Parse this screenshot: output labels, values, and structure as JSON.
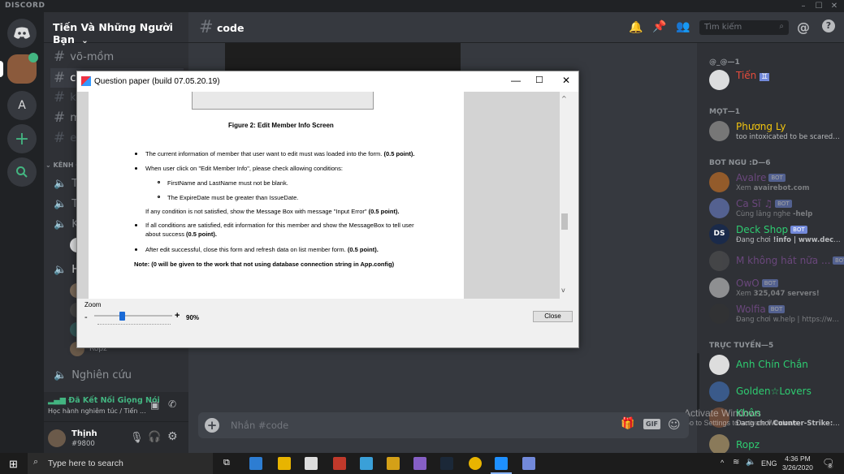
{
  "app": {
    "brand": "DISCORD"
  },
  "server": {
    "name": "Tiến Và Những Người Bạn"
  },
  "channels": [
    {
      "name": "võ-mồm"
    },
    {
      "name": "co"
    },
    {
      "name": "ki"
    },
    {
      "name": "m"
    },
    {
      "name": "e"
    }
  ],
  "voice_category": "KÊNH Đ",
  "voice_channels": [
    {
      "name": "Tì"
    },
    {
      "name": "Tì"
    },
    {
      "name": "Ka"
    },
    {
      "name": "H"
    }
  ],
  "voice_user_last": "Ropz",
  "voice_channel_research": "Nghiên cứu",
  "voice_status": {
    "title": "Đã Kết Nối Giọng Nói",
    "sub": "Học hành nghiêm túc / Tiến ..."
  },
  "user": {
    "name": "Thịnh",
    "tag": "#9800"
  },
  "chat": {
    "channel": "code",
    "placeholder": "Nhắn #code"
  },
  "search": {
    "placeholder": "Tìm kiếm"
  },
  "members": {
    "sections": [
      {
        "title": "@_@—1",
        "members": [
          {
            "name": "Tiến",
            "badge": "♊",
            "color": "#e74c3c",
            "status": ""
          }
        ]
      },
      {
        "title": "MỌT—1",
        "members": [
          {
            "name": "Phương Ly",
            "color": "#f1c40f",
            "status": "too intoxicated to be scared U..."
          }
        ]
      },
      {
        "title": "BOT NGU :D—6",
        "members": [
          {
            "name": "Avalre",
            "color": "#9b59b6",
            "bot": "BOT",
            "status_pre": "Xem ",
            "status": "avairebot.com"
          },
          {
            "name": "Ca Sĩ ♫",
            "color": "#9b59b6",
            "bot": "BOT",
            "status_pre": "Cùng lắng nghe ",
            "status": "-help"
          },
          {
            "name": "Deck Shop",
            "color": "#2ecc71",
            "bot": "BOT",
            "status_pre": "Đang chơi ",
            "status": "!info | www.decksh..."
          },
          {
            "name": "M không hát nữa ...",
            "color": "#9b59b6",
            "bot": "BOT",
            "status": ""
          },
          {
            "name": "OwO",
            "color": "#9b59b6",
            "bot": "BOT",
            "status_pre": "Xem ",
            "status": "325,047 servers!"
          },
          {
            "name": "Wolfia",
            "color": "#9b59b6",
            "bot": "BOT",
            "status_pre": "Đang chơi ",
            "status": "w.help | https://wo..."
          }
        ]
      },
      {
        "title": "TRỰC TUYẾN—5",
        "members": [
          {
            "name": "Anh Chín Chắn",
            "color": "#2ecc71"
          },
          {
            "name": "Golden☆Lovers",
            "color": "#2ecc71"
          },
          {
            "name": "Khôn",
            "color": "#2ecc71",
            "status_pre": "Đang chơi ",
            "status": "Counter-Strike: ..."
          },
          {
            "name": "Ropz",
            "color": "#2ecc71"
          }
        ]
      }
    ]
  },
  "watermark": {
    "line1": "Activate Windows",
    "line2": "Go to Settings to activate Windows."
  },
  "dialog": {
    "title": "Question paper (build 07.05.20.19)",
    "figure_caption": "Figure 2: Edit Member Info Screen",
    "bullets": [
      {
        "text": "The current information of member that user want to edit must was loaded into the form. ",
        "bold": "(0.5 point)."
      },
      {
        "text": "When user click on \"Edit Member Info\", please check allowing conditions:"
      }
    ],
    "sub_bullets": [
      "FirstName and LastName must not be blank.",
      "The ExpireDate must be greater than IssueDate."
    ],
    "fail_line": {
      "text": "If any condition is not satisfied, show the Message Box with message \"Input Error\" ",
      "bold": "(0.5 point)."
    },
    "bullet3": {
      "line1": "If all conditions are satisfied, edit information for this member and show the MessageBox to tell user",
      "line2_pre": "about success ",
      "line2_bold": "(0.5 point)."
    },
    "bullet4": {
      "text": "After edit successful, close this form and refresh data on list member form. ",
      "bold": "(0.5 point)."
    },
    "note": "Note: (0 will be given to the work that not using database connection string in App.config)",
    "zoom_label": "Zoom",
    "zoom_minus": "-",
    "zoom_plus": "+",
    "zoom_value": "90%",
    "zoom_level": 0.35,
    "close_label": "Close"
  },
  "taskbar": {
    "search_placeholder": "Type here to search",
    "lang": "ENG",
    "time": "4:36 PM",
    "date": "3/26/2020",
    "notif_count": "8"
  }
}
